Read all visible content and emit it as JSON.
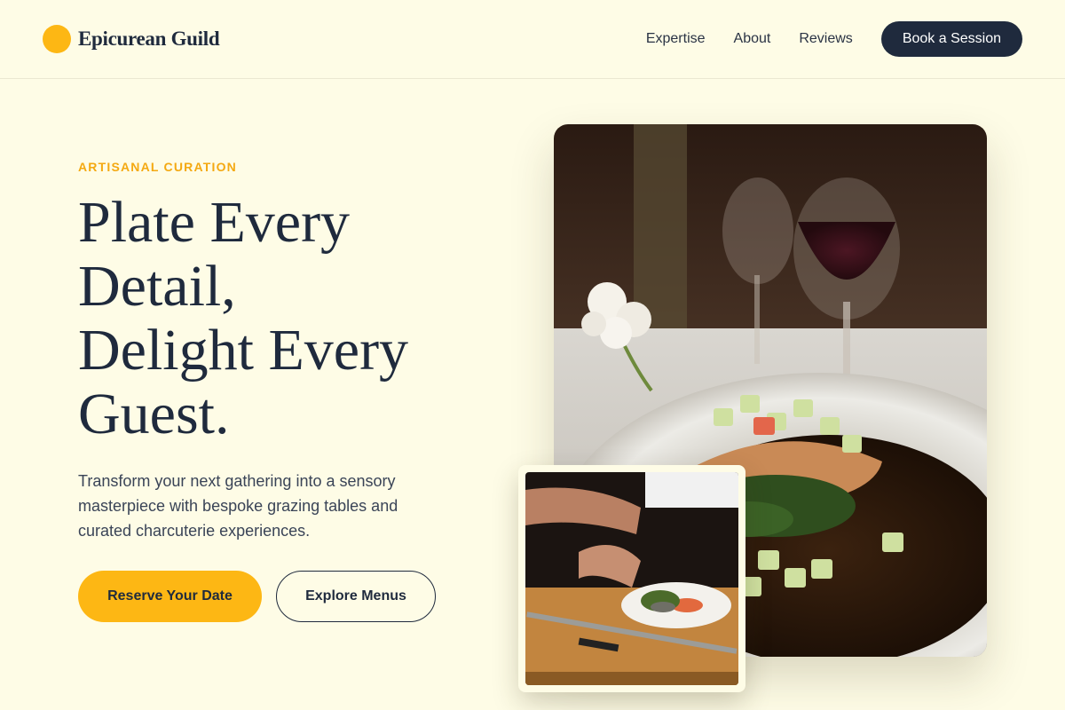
{
  "brand": {
    "name": "Epicurean Guild",
    "accent": "#FDB714"
  },
  "nav": {
    "links": [
      "Expertise",
      "About",
      "Reviews"
    ],
    "cta": "Book a Session"
  },
  "hero": {
    "eyebrow": "ARTISANAL CURATION",
    "headline_lines": [
      "Plate Every",
      "Detail,",
      "Delight Every",
      "Guest."
    ],
    "subcopy": "Transform your next gathering into a sensory masterpiece with bespoke grazing tables and curated charcuterie experiences.",
    "primary_button": "Reserve Your Date",
    "secondary_button": "Explore Menus"
  },
  "images": {
    "main": "plated-fish-dish-with-wine-glasses",
    "inset": "chef-plating-garnish"
  },
  "colors": {
    "background": "#FEFCE6",
    "dark": "#1F2A3D",
    "accent": "#FDB714",
    "eyebrow": "#F4A912"
  }
}
